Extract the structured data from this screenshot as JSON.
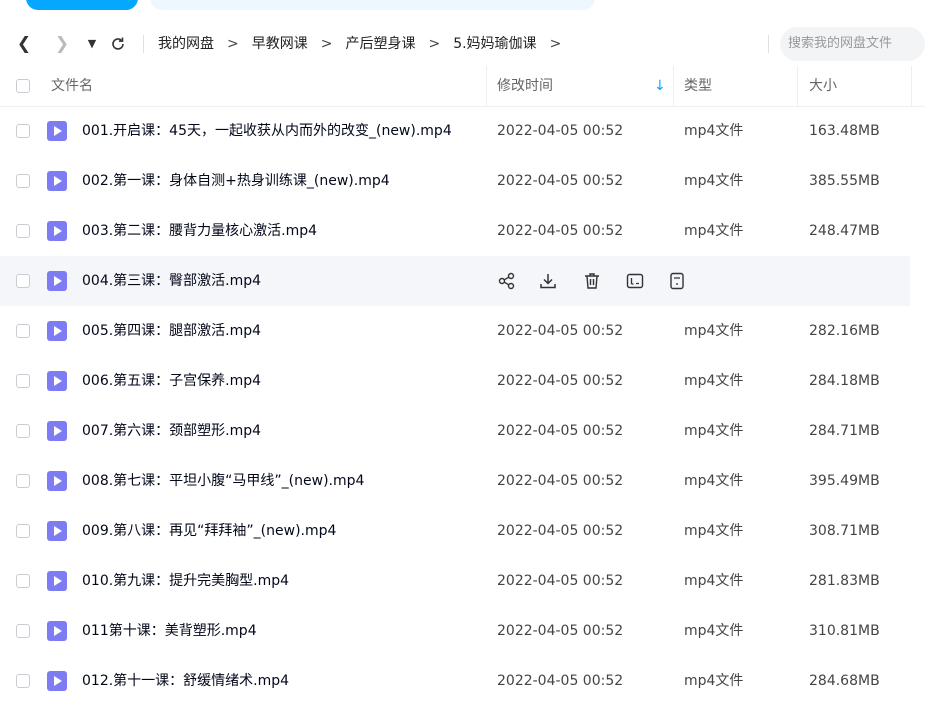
{
  "breadcrumb": {
    "items": [
      "我的网盘",
      "早教网课",
      "产后塑身课",
      "5.妈妈瑜伽课"
    ],
    "separator": ">"
  },
  "search": {
    "placeholder": "搜索我的网盘文件"
  },
  "columns": {
    "name": "文件名",
    "modified": "修改时间",
    "type": "类型",
    "size": "大小"
  },
  "colors": {
    "accent": "#06a7ff",
    "video_icon": "#7e7cf2",
    "hover_row": "#f5f6fa"
  },
  "files": [
    {
      "name": "001.开启课：45天，一起收获从内而外的改变_(new).mp4",
      "modified": "2022-04-05 00:52",
      "type": "mp4文件",
      "size": "163.48MB"
    },
    {
      "name": "002.第一课：身体自测+热身训练课_(new).mp4",
      "modified": "2022-04-05 00:52",
      "type": "mp4文件",
      "size": "385.55MB"
    },
    {
      "name": "003.第二课：腰背力量核心激活.mp4",
      "modified": "2022-04-05 00:52",
      "type": "mp4文件",
      "size": "248.47MB"
    },
    {
      "name": "004.第三课：臀部激活.mp4",
      "modified": "",
      "type": "",
      "size": ""
    },
    {
      "name": "005.第四课：腿部激活.mp4",
      "modified": "2022-04-05 00:52",
      "type": "mp4文件",
      "size": "282.16MB"
    },
    {
      "name": "006.第五课：子宫保养.mp4",
      "modified": "2022-04-05 00:52",
      "type": "mp4文件",
      "size": "284.18MB"
    },
    {
      "name": "007.第六课：颈部塑形.mp4",
      "modified": "2022-04-05 00:52",
      "type": "mp4文件",
      "size": "284.71MB"
    },
    {
      "name": "008.第七课：平坦小腹“马甲线”_(new).mp4",
      "modified": "2022-04-05 00:52",
      "type": "mp4文件",
      "size": "395.49MB"
    },
    {
      "name": "009.第八课：再见“拜拜袖”_(new).mp4",
      "modified": "2022-04-05 00:52",
      "type": "mp4文件",
      "size": "308.71MB"
    },
    {
      "name": "010.第九课：提升完美胸型.mp4",
      "modified": "2022-04-05 00:52",
      "type": "mp4文件",
      "size": "281.83MB"
    },
    {
      "name": "011第十课：美背塑形.mp4",
      "modified": "2022-04-05 00:52",
      "type": "mp4文件",
      "size": "310.81MB"
    },
    {
      "name": "012.第十一课：舒缓情绪术.mp4",
      "modified": "2022-04-05 00:52",
      "type": "mp4文件",
      "size": "284.68MB"
    }
  ],
  "hover_row_actions": [
    "share-icon",
    "download-icon",
    "delete-icon",
    "rename-icon",
    "copy-icon"
  ]
}
